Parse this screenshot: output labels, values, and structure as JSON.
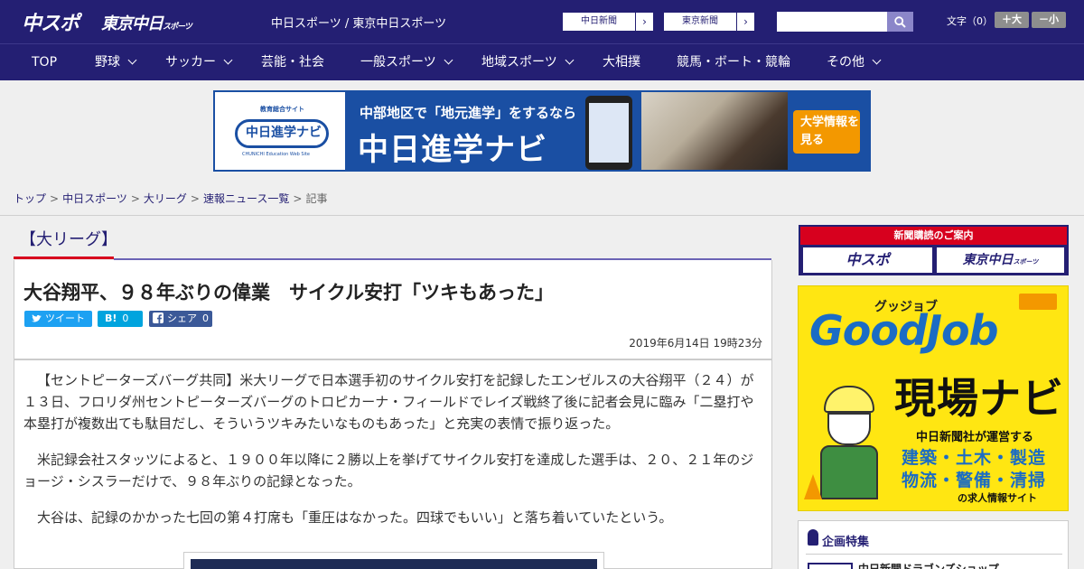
{
  "header": {
    "logo_chuspo": "中スポ",
    "logo_tokyo": "東京中日",
    "logo_tokyo_small": "スポーツ",
    "site_name": "中日スポーツ / 東京中日スポーツ",
    "paper_links": [
      "中日新聞",
      "東京新聞"
    ],
    "search": {
      "placeholder": "",
      "value": ""
    },
    "font_size_label": "文字（0）",
    "font_plus": "＋大",
    "font_minus": "－小"
  },
  "nav": [
    {
      "label": "TOP",
      "dropdown": false
    },
    {
      "label": "野球",
      "dropdown": true
    },
    {
      "label": "サッカー",
      "dropdown": true
    },
    {
      "label": "芸能・社会",
      "dropdown": false
    },
    {
      "label": "一般スポーツ",
      "dropdown": true
    },
    {
      "label": "地域スポーツ",
      "dropdown": true
    },
    {
      "label": "大相撲",
      "dropdown": false
    },
    {
      "label": "競馬・ボート・競輪",
      "dropdown": false
    },
    {
      "label": "その他",
      "dropdown": true
    }
  ],
  "banner": {
    "site_tag": "教育総合サイト",
    "logo_text": "中日進学ナビ",
    "logo_sub": "CHUNICHI Education Web Site",
    "line1": "中部地区で「地元進学」をするなら",
    "line2": "中日進学ナビ",
    "cta": "大学情報を見る"
  },
  "breadcrumb": {
    "links": [
      "トップ",
      "中日スポーツ",
      "大リーグ",
      "速報ニュース一覧"
    ],
    "current": "記事"
  },
  "category": "【大リーグ】",
  "article": {
    "title": "大谷翔平、９８年ぶりの偉業　サイクル安打「ツキもあった」",
    "share": {
      "tweet_label": "ツイート",
      "hatena_label": "B!",
      "hatena_count": "0",
      "facebook_label": "シェア",
      "facebook_count": "0"
    },
    "date": "2019年6月14日 19時23分",
    "paragraphs": [
      "【セントピーターズバーグ共同】米大リーグで日本選手初のサイクル安打を記録したエンゼルスの大谷翔平（２４）が１３日、フロリダ州セントピーターズバーグのトロピカーナ・フィールドでレイズ戦終了後に記者会見に臨み「二塁打や本塁打が複数出ても駄目だし、そういうツキみたいなものもあった」と充実の表情で振り返った。",
      "米記録会社スタッツによると、１９００年以降に２勝以上を挙げてサイクル安打を達成した選手は、２０、２１年のジョージ・シスラーだけで、９８年ぶりの記録となった。",
      "大谷は、記録のかかった七回の第４打席も「重圧はなかった。四球でもいい」と落ち着いていたという。"
    ]
  },
  "sidebar": {
    "subscribe_title": "新聞購読のご案内",
    "subscribe_chuspo": "中スポ",
    "subscribe_tokyo": "東京中日",
    "subscribe_tokyo_small": "スポーツ",
    "job_ad": {
      "sub": "グッジョブ",
      "title": "GoodJob",
      "navi": "現場ナビ",
      "desc1": "中日新聞社が運営する",
      "desc2": "建築・土木・製造",
      "desc3": "物流・警備・清掃",
      "desc4": "の求人情報サイト"
    },
    "feature_title": "企画特集",
    "feature_item": "中日新聞ドラゴンズショップ"
  },
  "colors": {
    "brand_navy": "#241f73",
    "accent_red": "#d7001e",
    "accent_purple": "#6b63b5"
  }
}
